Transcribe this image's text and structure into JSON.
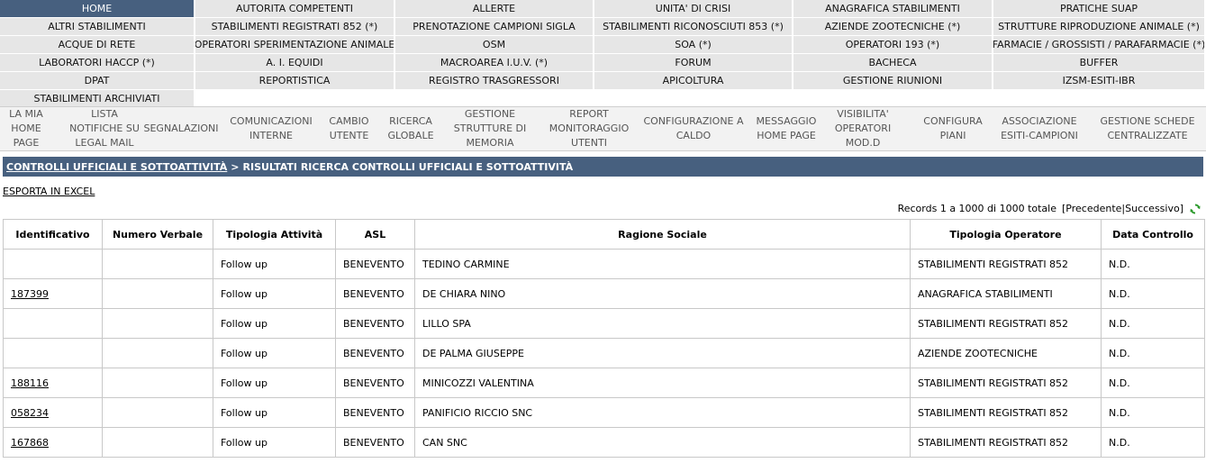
{
  "tabs": [
    {
      "label": "HOME",
      "active": true
    },
    {
      "label": "AUTORITA COMPETENTI"
    },
    {
      "label": "ALLERTE"
    },
    {
      "label": "UNITA' DI CRISI"
    },
    {
      "label": "ANAGRAFICA STABILIMENTI"
    },
    {
      "label": "PRATICHE SUAP"
    },
    {
      "label": "ALTRI STABILIMENTI"
    },
    {
      "label": "STABILIMENTI REGISTRATI 852 (*)"
    },
    {
      "label": "PRENOTAZIONE CAMPIONI SIGLA"
    },
    {
      "label": "STABILIMENTI RICONOSCIUTI 853 (*)"
    },
    {
      "label": "AZIENDE ZOOTECNICHE (*)"
    },
    {
      "label": "STRUTTURE RIPRODUZIONE ANIMALE (*)"
    },
    {
      "label": "ACQUE DI RETE"
    },
    {
      "label": "OPERATORI SPERIMENTAZIONE ANIMALE"
    },
    {
      "label": "OSM"
    },
    {
      "label": "SOA (*)"
    },
    {
      "label": "OPERATORI 193 (*)"
    },
    {
      "label": "FARMACIE / GROSSISTI / PARAFARMACIE (*)"
    },
    {
      "label": "LABORATORI HACCP (*)"
    },
    {
      "label": "A. I. EQUIDI"
    },
    {
      "label": "MACROAREA I.U.V. (*)"
    },
    {
      "label": "FORUM"
    },
    {
      "label": "BACHECA"
    },
    {
      "label": "BUFFER"
    },
    {
      "label": "DPAT"
    },
    {
      "label": "REPORTISTICA"
    },
    {
      "label": "REGISTRO TRASGRESSORI"
    },
    {
      "label": "APICOLTURA"
    },
    {
      "label": "GESTIONE RIUNIONI"
    },
    {
      "label": "IZSM-ESITI-IBR"
    },
    {
      "label": "STABILIMENTI ARCHIVIATI"
    }
  ],
  "toolbar": [
    {
      "label": "LA MIA\nHOME\nPAGE"
    },
    {
      "label": "LISTA\nNOTIFICHE SU\nLEGAL MAIL"
    },
    {
      "label": "SEGNALAZIONI"
    },
    {
      "label": "COMUNICAZIONI\nINTERNE"
    },
    {
      "label": "CAMBIO\nUTENTE"
    },
    {
      "label": "RICERCA\nGLOBALE"
    },
    {
      "label": "GESTIONE\nSTRUTTURE DI\nMEMORIA"
    },
    {
      "label": "REPORT\nMONITORAGGIO\nUTENTI"
    },
    {
      "label": "CONFIGURAZIONE A\nCALDO"
    },
    {
      "label": "MESSAGGIO\nHOME PAGE"
    },
    {
      "label": "VISIBILITA'\nOPERATORI\nMOD.D"
    },
    {
      "label": "CONFIGURA\nPIANI"
    },
    {
      "label": "ASSOCIAZIONE\nESITI-CAMPIONI"
    },
    {
      "label": "GESTIONE SCHEDE\nCENTRALIZZATE"
    }
  ],
  "breadcrumb": {
    "link": "CONTROLLI UFFICIALI E SOTTOATTIVITÀ",
    "separator": ">",
    "current": "RISULTATI RICERCA CONTROLLI UFFICIALI E SOTTOATTIVITÀ"
  },
  "export_label": "ESPORTA IN EXCEL",
  "records": {
    "summary": "Records 1 a 1000 di 1000 totale",
    "open": "[",
    "prev": "Precedente",
    "divider": "|",
    "next": "Successivo",
    "close": "]",
    "refresh_icon": "refresh-icon"
  },
  "table": {
    "headers": [
      "Identificativo",
      "Numero Verbale",
      "Tipologia Attività",
      "ASL",
      "Ragione Sociale",
      "Tipologia Operatore",
      "Data Controllo"
    ],
    "rows": [
      {
        "id": "",
        "verbale": "",
        "tipologia": "Follow up",
        "asl": "BENEVENTO",
        "ragione": "TEDINO CARMINE",
        "operatore": "STABILIMENTI REGISTRATI 852",
        "data": "N.D."
      },
      {
        "id": "187399",
        "verbale": "",
        "tipologia": "Follow up",
        "asl": "BENEVENTO",
        "ragione": "DE CHIARA NINO",
        "operatore": "ANAGRAFICA STABILIMENTI",
        "data": "N.D."
      },
      {
        "id": "",
        "verbale": "",
        "tipologia": "Follow up",
        "asl": "BENEVENTO",
        "ragione": "LILLO SPA",
        "operatore": "STABILIMENTI REGISTRATI 852",
        "data": "N.D."
      },
      {
        "id": "",
        "verbale": "",
        "tipologia": "Follow up",
        "asl": "BENEVENTO",
        "ragione": "DE PALMA GIUSEPPE",
        "operatore": "AZIENDE ZOOTECNICHE",
        "data": "N.D."
      },
      {
        "id": "188116",
        "verbale": "",
        "tipologia": "Follow up",
        "asl": "BENEVENTO",
        "ragione": "MINICOZZI VALENTINA",
        "operatore": "STABILIMENTI REGISTRATI 852",
        "data": "N.D."
      },
      {
        "id": "058234",
        "verbale": "",
        "tipologia": "Follow up",
        "asl": "BENEVENTO",
        "ragione": "PANIFICIO RICCIO SNC",
        "operatore": "STABILIMENTI REGISTRATI 852",
        "data": "N.D."
      },
      {
        "id": "167868",
        "verbale": "",
        "tipologia": "Follow up",
        "asl": "BENEVENTO",
        "ragione": "CAN SNC",
        "operatore": "STABILIMENTI REGISTRATI 852",
        "data": "N.D."
      }
    ]
  },
  "colors": {
    "accent": "#47607f",
    "tab_bg": "#e6e6e6",
    "toolbar_bg": "#f2f2f2"
  }
}
